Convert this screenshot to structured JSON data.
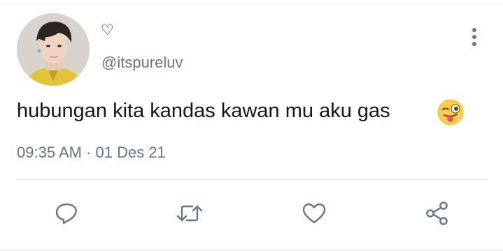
{
  "user": {
    "display_name": "♡",
    "handle": "@itspureluv"
  },
  "tweet": {
    "text": "hubungan kita kandas kawan mu aku gas",
    "emoji": "winking-face-with-tongue",
    "timestamp": "09:35 AM · 01 Des 21"
  },
  "icons": {
    "color": "#657786"
  },
  "actions": [
    {
      "name": "reply",
      "icon": "reply-icon"
    },
    {
      "name": "retweet",
      "icon": "retweet-icon"
    },
    {
      "name": "like",
      "icon": "heart-icon"
    },
    {
      "name": "share",
      "icon": "share-icon"
    }
  ]
}
